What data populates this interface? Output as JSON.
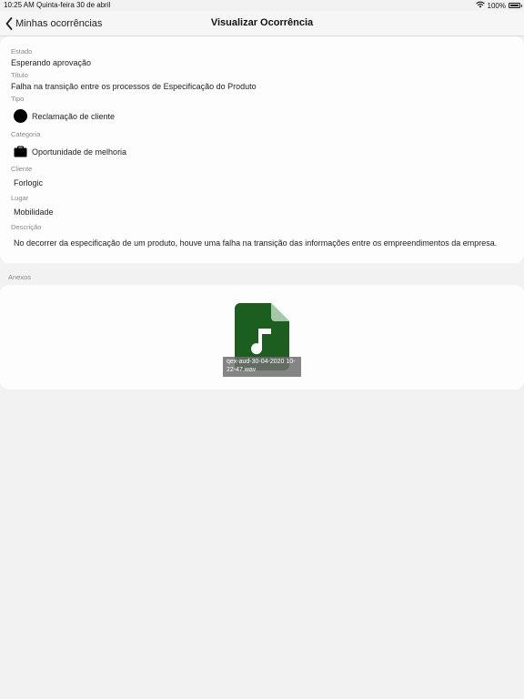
{
  "status_bar": {
    "time": "10:25 AM",
    "date": "Quinta-feira 30 de abril",
    "battery": "100%",
    "icons": [
      "wifi-icon",
      "battery-icon"
    ]
  },
  "nav": {
    "back_label": "Minhas ocorrências",
    "title": "Visualizar Ocorrência"
  },
  "details": {
    "estado": {
      "label": "Estado",
      "value": "Esperando aprovação"
    },
    "titulo": {
      "label": "Título",
      "value": "Falha na transição entre os processos de Especificação do Produto"
    },
    "tipo": {
      "label": "Tipo",
      "value": "Reclamação de cliente",
      "icon": "circle-icon"
    },
    "categoria": {
      "label": "Categoria",
      "value": "Oportunidade de melhoria",
      "icon": "briefcase-icon"
    },
    "cliente": {
      "label": "Cliente",
      "value": "Forlogic"
    },
    "lugar": {
      "label": "Lugar",
      "value": "Mobilidade"
    },
    "descricao": {
      "label": "Descrição",
      "value": "No decorrer da especificação de um produto, houve uma falha na transição das informações entre os empreendimentos da empresa."
    }
  },
  "attachments": {
    "label": "Anexos",
    "files": [
      {
        "name": "qex-aud-30-04-2020 10-22-47.wav",
        "icon": "audio-file-icon",
        "color": "#1b5e20"
      }
    ]
  }
}
